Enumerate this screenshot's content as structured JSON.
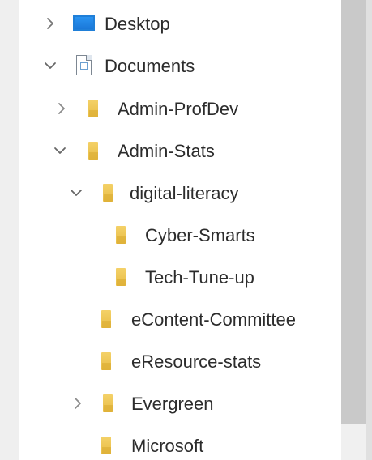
{
  "tree": {
    "items": [
      {
        "label": "Desktop",
        "chevron": "chevron-right-icon",
        "icon": "desktop-icon",
        "level": 0,
        "expanded": false
      },
      {
        "label": "Documents",
        "chevron": "chevron-down-icon",
        "icon": "documents-icon",
        "level": 0,
        "expanded": true
      },
      {
        "label": "Admin-ProfDev",
        "chevron": "chevron-right-icon",
        "icon": "folder-icon",
        "level": 1,
        "expanded": false
      },
      {
        "label": "Admin-Stats",
        "chevron": "chevron-down-icon",
        "icon": "folder-icon",
        "level": 1,
        "expanded": true
      },
      {
        "label": "digital-literacy",
        "chevron": "chevron-down-icon",
        "icon": "folder-icon",
        "level": 2,
        "expanded": true
      },
      {
        "label": "Cyber-Smarts",
        "chevron": "",
        "icon": "folder-icon",
        "level": 3,
        "expanded": false
      },
      {
        "label": "Tech-Tune-up",
        "chevron": "",
        "icon": "folder-icon",
        "level": 3,
        "expanded": false
      },
      {
        "label": "eContent-Committee",
        "chevron": "",
        "icon": "folder-icon",
        "level": 2,
        "expanded": false
      },
      {
        "label": "eResource-stats",
        "chevron": "",
        "icon": "folder-icon",
        "level": 2,
        "expanded": false
      },
      {
        "label": "Evergreen",
        "chevron": "chevron-right-icon",
        "icon": "folder-icon",
        "level": 2,
        "expanded": false
      },
      {
        "label": "Microsoft",
        "chevron": "",
        "icon": "folder-icon",
        "level": 2,
        "expanded": false
      }
    ]
  },
  "colors": {
    "panel_background": "#ffffff",
    "window_background": "#e9e9e9",
    "scrollbar_thumb": "#c9c9c9",
    "folder_yellow": "#f1c94f",
    "desktop_blue": "#1f7fd8",
    "chevron_gray": "#666666"
  }
}
